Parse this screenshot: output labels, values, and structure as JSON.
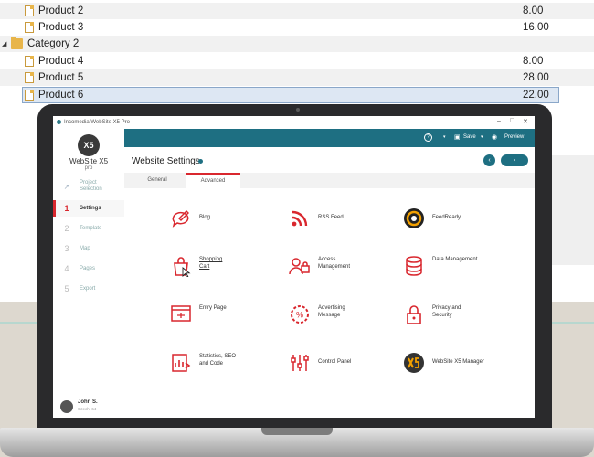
{
  "tree": {
    "rows": [
      {
        "label": "Product 2",
        "value": "8.00",
        "type": "item"
      },
      {
        "label": "Product 3",
        "value": "16.00",
        "type": "item"
      },
      {
        "label": "Category 2",
        "value": "",
        "type": "folder"
      },
      {
        "label": "Product 4",
        "value": "8.00",
        "type": "item"
      },
      {
        "label": "Product 5",
        "value": "28.00",
        "type": "item"
      },
      {
        "label": "Product 6",
        "value": "22.00",
        "type": "item",
        "selected": true
      }
    ]
  },
  "app": {
    "window_title": "Incomedia WebSite X5 Pro",
    "logo_text": "WebSite X5",
    "logo_sub": "pro",
    "logo_mark": "X5",
    "toolbar": {
      "help": "?",
      "save": "Save",
      "preview": "Preview"
    },
    "page_title": "Website Settings",
    "nav_prev": "‹",
    "nav_next": "›",
    "tabs": [
      {
        "label": "General"
      },
      {
        "label": "Advanced"
      }
    ],
    "sidebar": [
      {
        "num": "↗",
        "label": "Project Selection"
      },
      {
        "num": "1",
        "label": "Settings"
      },
      {
        "num": "2",
        "label": "Template"
      },
      {
        "num": "3",
        "label": "Map"
      },
      {
        "num": "4",
        "label": "Pages"
      },
      {
        "num": "5",
        "label": "Export"
      }
    ],
    "user": {
      "name": "John S.",
      "sub": "Czech, 64"
    },
    "features": [
      {
        "label": "Blog",
        "icon": "blog-icon"
      },
      {
        "label": "RSS Feed",
        "icon": "rss-icon"
      },
      {
        "label": "FeedReady",
        "icon": "feedready-icon"
      },
      {
        "label": "Shopping Cart",
        "icon": "shopping-cart-icon"
      },
      {
        "label": "Access Management",
        "icon": "access-management-icon"
      },
      {
        "label": "Data Management",
        "icon": "database-icon"
      },
      {
        "label": "Entry Page",
        "icon": "entry-page-icon"
      },
      {
        "label": "Advertising Message",
        "icon": "advertising-icon"
      },
      {
        "label": "Privacy and Security",
        "icon": "lock-icon"
      },
      {
        "label": "Statistics, SEO and Code",
        "icon": "statistics-icon"
      },
      {
        "label": "Control Panel",
        "icon": "control-panel-icon"
      },
      {
        "label": "WebSite X5 Manager",
        "icon": "x5-manager-icon"
      }
    ]
  },
  "colors": {
    "accent": "#d9272e",
    "teal": "#1e6f82"
  }
}
